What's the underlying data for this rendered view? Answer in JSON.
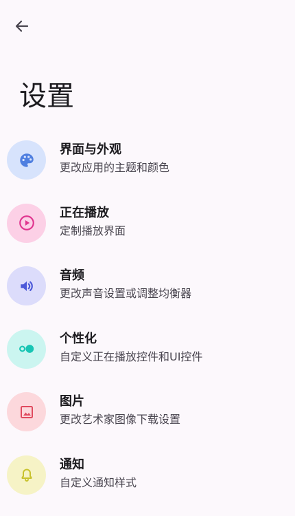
{
  "header": {
    "back_icon": "arrow-left-icon",
    "title": "设置"
  },
  "items": [
    {
      "key": "appearance",
      "title": "界面与外观",
      "subtitle": "更改应用的主题和颜色",
      "icon": "palette-icon",
      "icon_bg": "#d7e3fc",
      "icon_color": "#4f7fe0"
    },
    {
      "key": "now-playing",
      "title": "正在播放",
      "subtitle": "定制播放界面",
      "icon": "play-circle-icon",
      "icon_bg": "#fcd0e6",
      "icon_color": "#e0358f"
    },
    {
      "key": "audio",
      "title": "音频",
      "subtitle": "更改声音设置或调整均衡器",
      "icon": "volume-icon",
      "icon_bg": "#dcdcfb",
      "icon_color": "#4b58d8"
    },
    {
      "key": "personalize",
      "title": "个性化",
      "subtitle": "自定义正在播放控件和UI控件",
      "icon": "toggle-icon",
      "icon_bg": "#cbf5f0",
      "icon_color": "#19c5b4"
    },
    {
      "key": "images",
      "title": "图片",
      "subtitle": "更改艺术家图像下载设置",
      "icon": "image-icon",
      "icon_bg": "#fcd8dc",
      "icon_color": "#e04a5e"
    },
    {
      "key": "notifications",
      "title": "通知",
      "subtitle": "自定义通知样式",
      "icon": "bell-icon",
      "icon_bg": "#f6f3c6",
      "icon_color": "#c8c22c"
    }
  ]
}
